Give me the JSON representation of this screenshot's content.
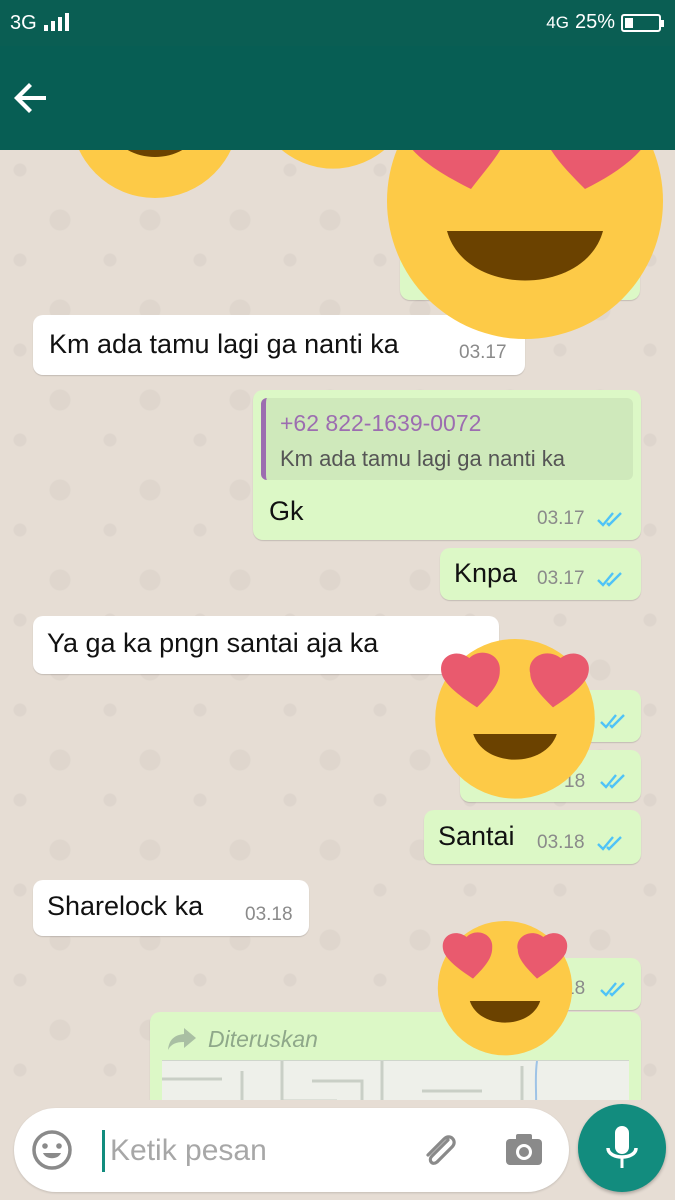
{
  "status_bar": {
    "network": "3G",
    "network_right": "4G",
    "battery_text": "25%",
    "battery_level": 0.25
  },
  "chat": {
    "messages": [
      {
        "direction": "incoming",
        "text": "Km ada tamu lagi ga nanti ka",
        "time": "03.17"
      },
      {
        "direction": "outgoing",
        "quote_name": "+62 822-1639-0072",
        "quote_text": "Km ada tamu lagi ga nanti ka",
        "text": "Gk",
        "time": "03.17",
        "ticks": "read"
      },
      {
        "direction": "outgoing",
        "text": "Knpa",
        "time": "03.17",
        "ticks": "read"
      },
      {
        "direction": "incoming",
        "text": "Ya ga ka pngn santai aja ka",
        "time": ""
      },
      {
        "direction": "outgoing",
        "text": "",
        "time": "18",
        "ticks": "read"
      },
      {
        "direction": "outgoing",
        "text": "Santai",
        "time": "03.18",
        "ticks": "read"
      },
      {
        "direction": "incoming",
        "text": "Sharelock ka",
        "time": "03.18"
      },
      {
        "direction": "outgoing",
        "text": "",
        "time": "18",
        "ticks": "read"
      },
      {
        "direction": "outgoing",
        "forwarded_label": "Diteruskan",
        "type": "location"
      }
    ]
  },
  "input": {
    "placeholder": "Ketik pesan"
  },
  "colors": {
    "header": "#075e54",
    "outgoing_bubble": "#dcf8c6",
    "incoming_bubble": "#ffffff",
    "read_ticks": "#4fc3f7",
    "accent": "#128c7e"
  },
  "icons": [
    "back-arrow-icon",
    "emoji-icon",
    "attachment-icon",
    "camera-icon",
    "mic-icon",
    "forward-icon",
    "double-tick-icon"
  ]
}
